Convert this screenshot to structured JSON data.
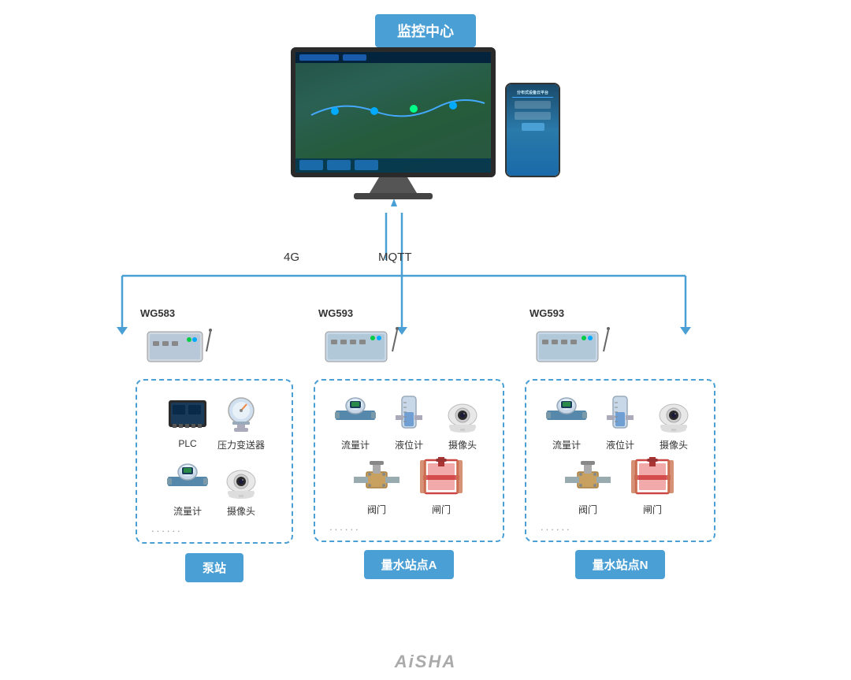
{
  "header": {
    "monitor_center": "监控中心"
  },
  "protocols": {
    "left": "4G",
    "right": "MQTT"
  },
  "columns": [
    {
      "id": "pump-station",
      "gateway": "WG583",
      "devices": [
        {
          "name": "PLC",
          "type": "plc"
        },
        {
          "name": "压力变送器",
          "type": "pressure"
        },
        {
          "name": "流量计",
          "type": "flow"
        },
        {
          "name": "摄像头",
          "type": "camera"
        }
      ],
      "has_valve_row": false,
      "more": "......",
      "station_label": "泵站"
    },
    {
      "id": "flow-station-a",
      "gateway": "WG593",
      "devices": [
        {
          "name": "流量计",
          "type": "flow"
        },
        {
          "name": "液位计",
          "type": "level"
        },
        {
          "name": "摄像头",
          "type": "camera"
        },
        {
          "name": "阀门",
          "type": "valve"
        },
        {
          "name": "闸门",
          "type": "gate"
        }
      ],
      "has_valve_row": true,
      "more": "......",
      "station_label": "量水站点A"
    },
    {
      "id": "flow-station-n",
      "gateway": "WG593",
      "devices": [
        {
          "name": "流量计",
          "type": "flow"
        },
        {
          "name": "液位计",
          "type": "level"
        },
        {
          "name": "摄像头",
          "type": "camera"
        },
        {
          "name": "阀门",
          "type": "valve"
        },
        {
          "name": "闸门",
          "type": "gate"
        }
      ],
      "has_valve_row": true,
      "more": "......",
      "station_label": "量水站点N"
    }
  ],
  "watermark": "AiSHA"
}
